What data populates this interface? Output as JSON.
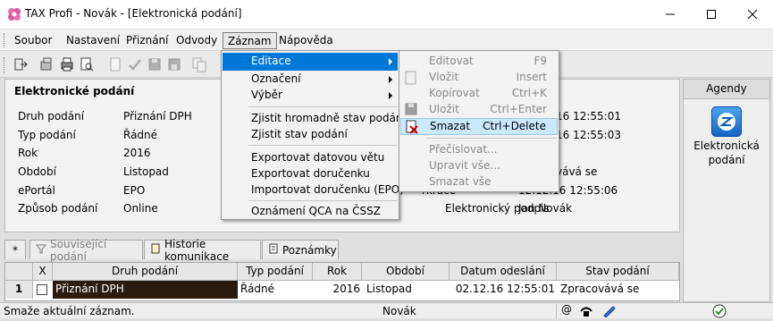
{
  "window": {
    "title": "TAX Profi - Novák - [Elektronická podání]"
  },
  "menubar": [
    {
      "label": "Soubor"
    },
    {
      "label": "Nastavení"
    },
    {
      "label": "Přiznání"
    },
    {
      "label": "Odvody"
    },
    {
      "label": "Záznam"
    },
    {
      "label": "Nápověda"
    }
  ],
  "panel": {
    "heading": "Elektronické podání",
    "fields": [
      {
        "label": "Druh podání",
        "value": "Přiznání DPH"
      },
      {
        "label": "Typ podání",
        "value": "Řádné"
      },
      {
        "label": "Rok",
        "value": "2016"
      },
      {
        "label": "Období",
        "value": "Listopad"
      },
      {
        "label": "ePortál",
        "value": "EPO"
      },
      {
        "label": "Způsob podání",
        "value": "Online"
      }
    ],
    "right_values": [
      "02.12.16 12:55:01",
      "02.12.16 12:55:03",
      "Zpracovává se",
      "02.12.16 12:55:06",
      "Jan Novák"
    ],
    "right_value_prefixes": [
      "16 12:55:01",
      "16 12:55:03",
      "vává se",
      "12.12.16 12:55:06",
      "Jan Novák"
    ],
    "partial_label": "rkrace",
    "signature_label": "Elektronický podpis"
  },
  "agendy": {
    "title": "Agendy",
    "item_label": "Elektronická podání"
  },
  "tabs": [
    {
      "label": "*"
    },
    {
      "label": "Související podání"
    },
    {
      "label": "Historie komunikace"
    },
    {
      "label": "Poznámky"
    }
  ],
  "grid": {
    "headers": [
      "X",
      "Druh podání",
      "Typ podání",
      "Rok",
      "Období",
      "Datum odeslání",
      "Stav podání"
    ],
    "rows": [
      {
        "num": "1",
        "druh": "Přiznání DPH",
        "typ": "Řádné",
        "rok": "2016",
        "obdobi": "Listopad",
        "datum": "02.12.16 12:55:01",
        "stav": "Zpracovává se"
      }
    ]
  },
  "status": {
    "message": "Smaže aktuální záznam.",
    "user": "Novák"
  },
  "menu_zaznam": {
    "items": [
      {
        "label": "Editace",
        "submenu": true
      },
      {
        "label": "Označení",
        "submenu": true
      },
      {
        "label": "Výběr",
        "submenu": true
      },
      {
        "label": "Zjistit hromadně stav podání"
      },
      {
        "label": "Zjistit stav podání"
      },
      {
        "label": "Exportovat datovou větu"
      },
      {
        "label": "Exportovat doručenku"
      },
      {
        "label": "Importovat doručenku (EPO)"
      },
      {
        "label": "Oznámení QCA na ČSSZ"
      }
    ]
  },
  "menu_editace": {
    "items": [
      {
        "label": "Editovat",
        "shortcut": "F9"
      },
      {
        "label": "Vložit",
        "shortcut": "Insert"
      },
      {
        "label": "Kopírovat",
        "shortcut": "Ctrl+K"
      },
      {
        "label": "Uložit",
        "shortcut": "Ctrl+Enter"
      },
      {
        "label": "Smazat",
        "shortcut": "Ctrl+Delete"
      },
      {
        "label": "Přečíslovat..."
      },
      {
        "label": "Upravit vše..."
      },
      {
        "label": "Smazat vše"
      }
    ]
  },
  "colors": {
    "accent": "#0078d7",
    "highlight": "#cce8ff",
    "selected_row": "#2b1a0e"
  }
}
